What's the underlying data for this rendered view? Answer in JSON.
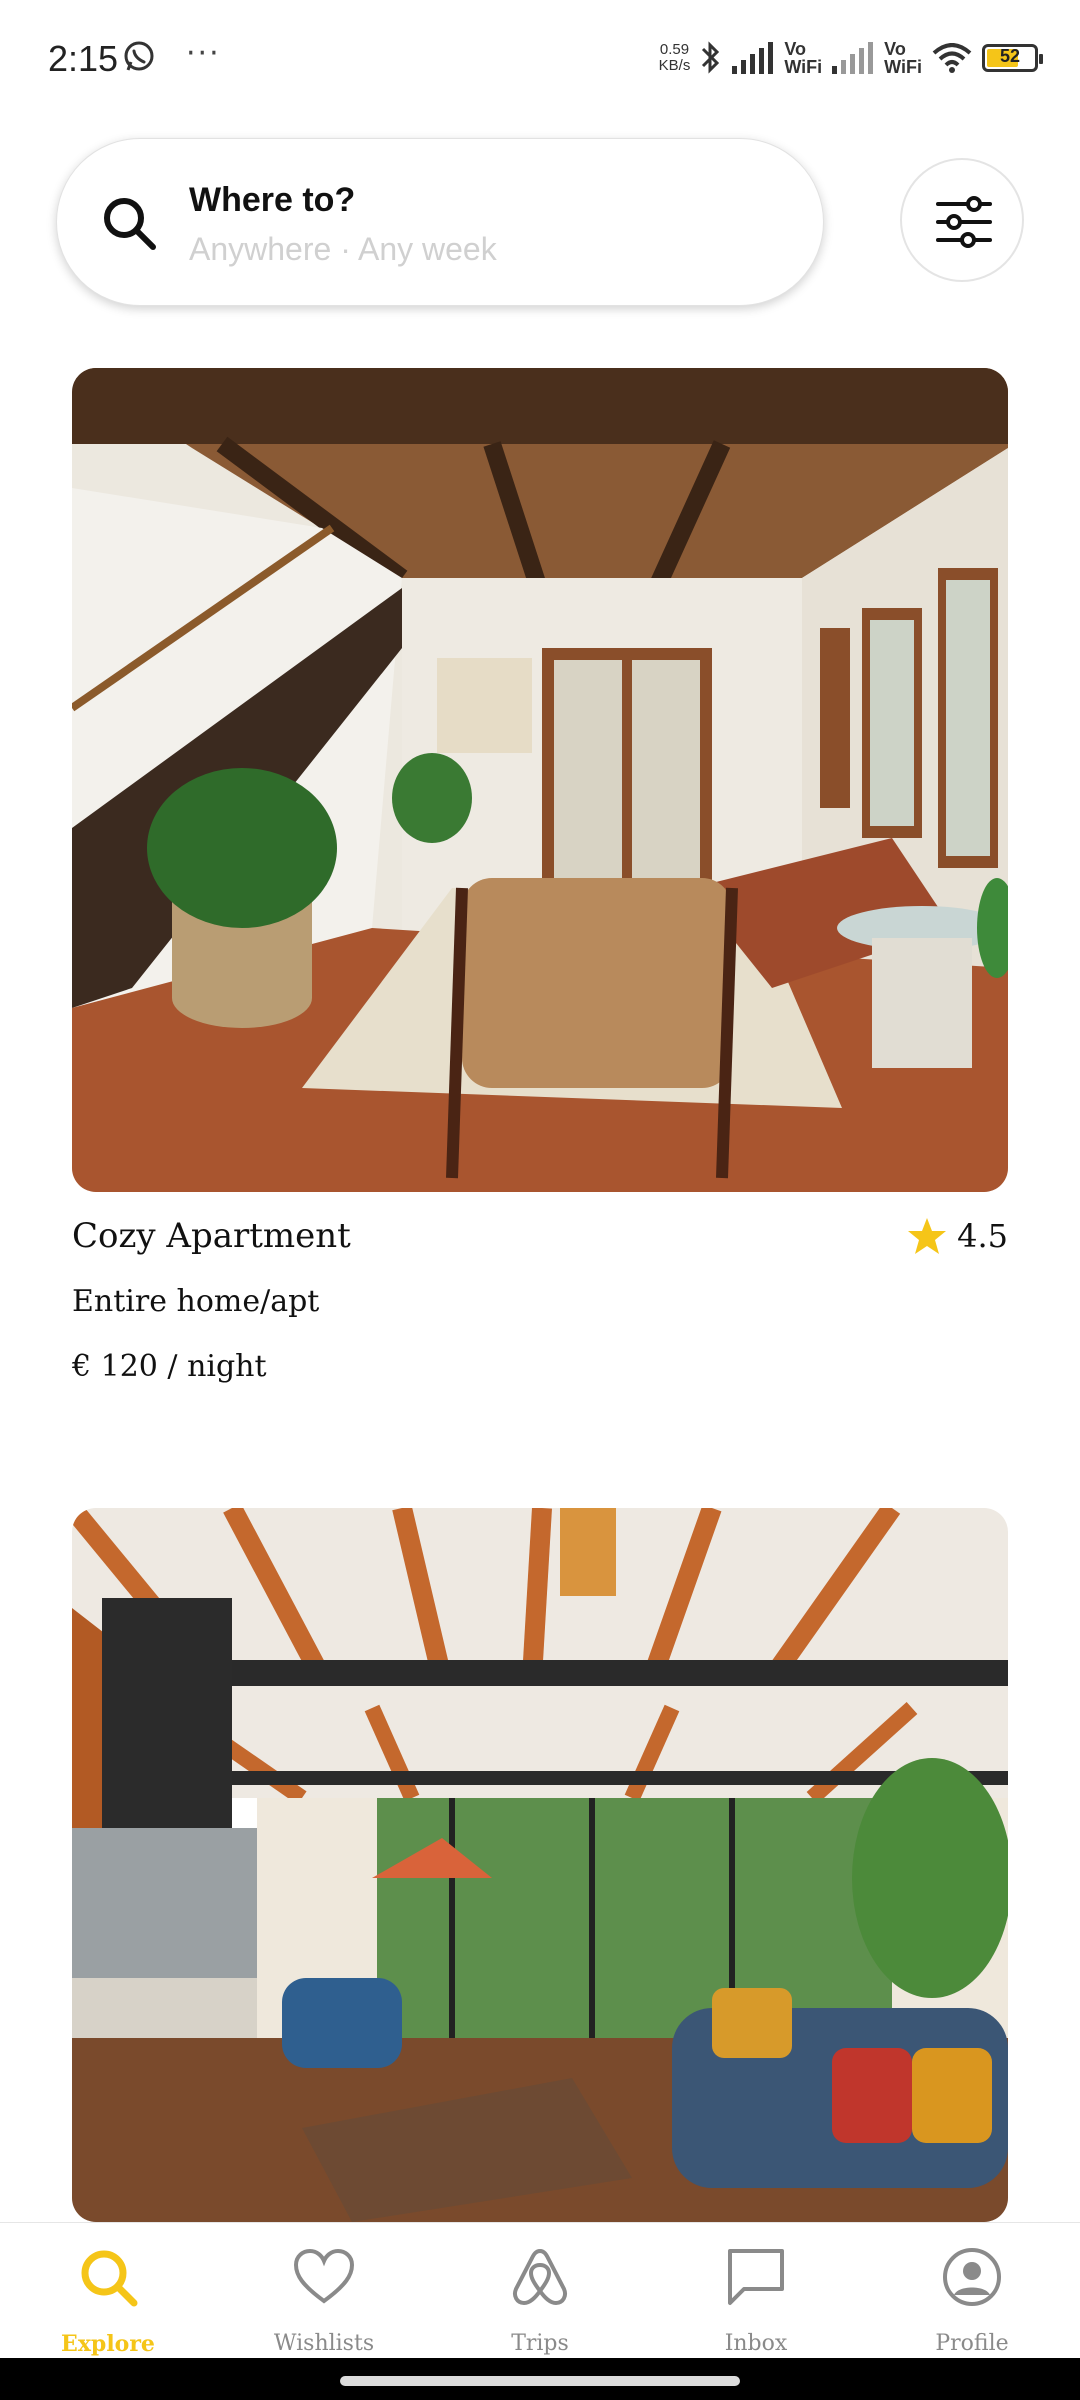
{
  "status_bar": {
    "time": "2:15",
    "more": "···",
    "speed_value": "0.59",
    "speed_unit": "KB/s",
    "vo1": "Vo",
    "wifi1": "WiFi",
    "vo2": "Vo",
    "wifi2": "WiFi",
    "battery": "52"
  },
  "search": {
    "title": "Where to?",
    "subtitle": "Anywhere · Any week"
  },
  "listings": [
    {
      "title": "Cozy Apartment",
      "rating": "4.5",
      "type": "Entire home/apt",
      "price": "€ 120 / night"
    }
  ],
  "nav": {
    "items": [
      {
        "label": "Explore",
        "icon": "search-icon",
        "active": true
      },
      {
        "label": "Wishlists",
        "icon": "heart-icon"
      },
      {
        "label": "Trips",
        "icon": "airbnb-logo-icon"
      },
      {
        "label": "Inbox",
        "icon": "chat-icon"
      },
      {
        "label": "Profile",
        "icon": "user-circle-icon"
      }
    ]
  },
  "colors": {
    "accent": "#f5c518",
    "inactive": "#8a8a8a"
  }
}
